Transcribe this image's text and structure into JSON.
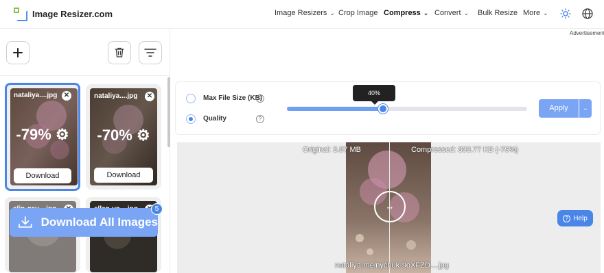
{
  "header": {
    "brand": "Image Resizer.com",
    "nav": [
      {
        "label": "Image Resizers",
        "has_dropdown": true
      },
      {
        "label": "Crop Image",
        "has_dropdown": false
      },
      {
        "label": "Compress",
        "has_dropdown": true,
        "active": true
      },
      {
        "label": "Convert",
        "has_dropdown": true
      },
      {
        "label": "Bulk Resize",
        "has_dropdown": false
      },
      {
        "label": "More",
        "has_dropdown": true
      }
    ],
    "icons": [
      "sun-icon",
      "globe-icon"
    ],
    "ad_label": "Advertisement"
  },
  "toolbar": {
    "icons": [
      "plus-icon",
      "trash-icon",
      "filter-icon"
    ]
  },
  "cards": [
    {
      "filename": "nataliya....jpg",
      "reduction": "-79%",
      "download_label": "Download",
      "selected": true
    },
    {
      "filename": "nataliya....jpg",
      "reduction": "-70%",
      "download_label": "Download",
      "selected": false
    },
    {
      "filename": "alin-gav....jpg",
      "selected": false
    },
    {
      "filename": "ellen-vo....jpg",
      "selected": false
    }
  ],
  "download_all": {
    "label": "Download All Images",
    "count": "5"
  },
  "settings": {
    "max_size_label": "Max File Size (KB)",
    "quality_label": "Quality",
    "quality_selected": true,
    "slider_tooltip": "40%",
    "slider_value": 0.4,
    "apply_label": "Apply"
  },
  "preview": {
    "original": "Original:  3.87 MB",
    "compressed": "Compressed:  803.77 KB (-79%)",
    "filename": "nataliya-melnychuk-9oXFZD....jpg"
  },
  "help_label": "Help",
  "colors": {
    "accent": "#4a86e8",
    "button": "#7aa5f5"
  }
}
